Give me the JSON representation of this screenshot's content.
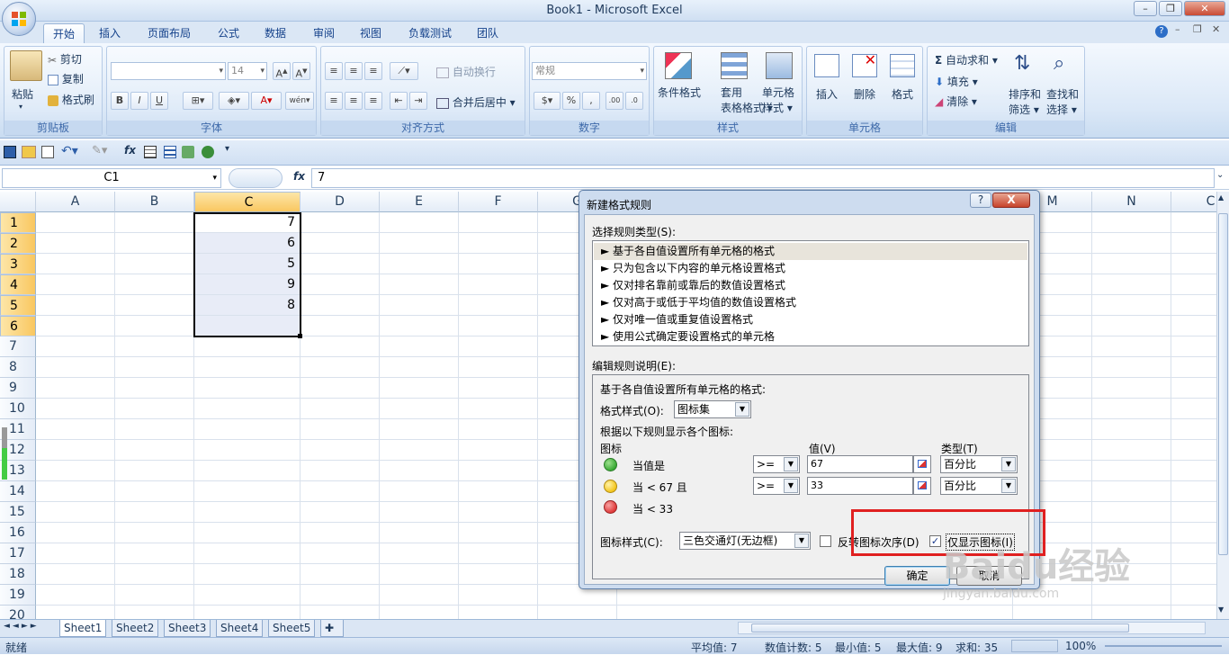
{
  "window": {
    "title": "Book1 - Microsoft Excel"
  },
  "tabs": [
    "开始",
    "插入",
    "页面布局",
    "公式",
    "数据",
    "审阅",
    "视图",
    "负载测试",
    "团队"
  ],
  "ribbon": {
    "clipboard": {
      "paste": "粘贴",
      "cut": "剪切",
      "copy": "复制",
      "painter": "格式刷",
      "label": "剪贴板"
    },
    "font": {
      "font_size": "14",
      "label": "字体"
    },
    "alignment": {
      "wrap": "自动换行",
      "merge": "合并后居中",
      "label": "对齐方式"
    },
    "number": {
      "format": "常规",
      "label": "数字"
    },
    "styles": {
      "conditional": "条件格式",
      "table": "套用",
      "table2": "表格格式",
      "cell": "单元格",
      "cell2": "样式",
      "label": "样式"
    },
    "cells": {
      "insert": "插入",
      "delete": "删除",
      "format": "格式",
      "label": "单元格"
    },
    "editing": {
      "autosum": "自动求和",
      "fill": "填充",
      "clear": "清除",
      "sort": "排序和",
      "sort2": "筛选",
      "find": "查找和",
      "find2": "选择",
      "label": "编辑"
    }
  },
  "formula_bar": {
    "name_box": "C1",
    "fx": "fx",
    "value": "7"
  },
  "columns": [
    "A",
    "B",
    "C",
    "D",
    "E",
    "F",
    "G",
    "M",
    "N",
    "C"
  ],
  "rows": [
    "1",
    "2",
    "3",
    "4",
    "5",
    "6",
    "7",
    "8",
    "9",
    "10",
    "11",
    "12",
    "13",
    "14",
    "15",
    "16",
    "17",
    "18",
    "19",
    "20"
  ],
  "cells_c": [
    "7",
    "6",
    "5",
    "9",
    "8"
  ],
  "sheets": [
    "Sheet1",
    "Sheet2",
    "Sheet3",
    "Sheet4",
    "Sheet5"
  ],
  "status": {
    "ready": "就绪",
    "avg": "平均值: 7",
    "count": "数值计数: 5",
    "min": "最小值: 5",
    "max": "最大值: 9",
    "sum": "求和: 35",
    "zoom": "100%"
  },
  "dialog": {
    "title": "新建格式规则",
    "help": "?",
    "close": "X",
    "select_type_label": "选择规则类型(S):",
    "rule_types": [
      "► 基于各自值设置所有单元格的格式",
      "► 只为包含以下内容的单元格设置格式",
      "► 仅对排名靠前或靠后的数值设置格式",
      "► 仅对高于或低于平均值的数值设置格式",
      "► 仅对唯一值或重复值设置格式",
      "► 使用公式确定要设置格式的单元格"
    ],
    "edit_desc_label": "编辑规则说明(E):",
    "desc_title": "基于各自值设置所有单元格的格式:",
    "format_style_label": "格式样式(O):",
    "format_style_value": "图标集",
    "show_rule_label": "根据以下规则显示各个图标:",
    "col_icon": "图标",
    "col_value": "值(V)",
    "col_type": "类型(T)",
    "icon_rows": [
      {
        "text": "当值是",
        "op": ">=",
        "value": "67",
        "type": "百分比",
        "color": "#3aaa35"
      },
      {
        "text": "当 < 67 且",
        "op": ">=",
        "value": "33",
        "type": "百分比",
        "color": "#f3c51b"
      },
      {
        "text": "当 < 33",
        "color": "#e03a3a"
      }
    ],
    "icon_style_label": "图标样式(C):",
    "icon_style_value": "三色交通灯(无边框)",
    "reverse_label": "反转图标次序(D)",
    "show_icon_only_label": "仅显示图标(I)",
    "show_icon_only_checked": "✓",
    "ok": "确定",
    "cancel": "取消"
  },
  "watermark": "Baidu经验",
  "watermark_sub": "jingyan.baidu.com"
}
